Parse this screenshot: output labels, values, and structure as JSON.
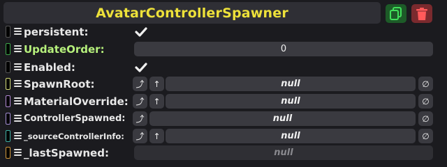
{
  "header": {
    "title": "AvatarControllerSpawner",
    "duplicate_icon": "duplicate-icon",
    "delete_icon": "trash-icon"
  },
  "colors": {
    "title": "#ede13a",
    "duplicate_button": "#1d5b28",
    "delete_button": "#7a2a2e"
  },
  "fields": [
    {
      "label": "persistent:",
      "kind": "checkbox",
      "checked": true,
      "swatch": "#444444"
    },
    {
      "label": "UpdateOrder:",
      "kind": "number",
      "value": "0",
      "swatch": "#3ea84a"
    },
    {
      "label": "Enabled:",
      "kind": "checkbox",
      "checked": true,
      "swatch": "#444444"
    },
    {
      "label": "SpawnRoot:",
      "kind": "ref",
      "value": "null",
      "swatch": "#d7e07a"
    },
    {
      "label": "MaterialOverride:",
      "kind": "ref",
      "value": "null",
      "swatch": "#b38ad6"
    },
    {
      "label": "ControllerSpawned:",
      "kind": "ref",
      "value": "null",
      "swatch": "#a690d8"
    },
    {
      "label": "_sourceControllerInfo:",
      "kind": "ref",
      "value": "null",
      "swatch": "#3fb3a6"
    },
    {
      "label": "_lastSpawned:",
      "kind": "readonly",
      "value": "null",
      "swatch": "#d69a3a"
    }
  ],
  "buttons": {
    "jump": "⤴",
    "up": "↑",
    "clear": "∅"
  }
}
